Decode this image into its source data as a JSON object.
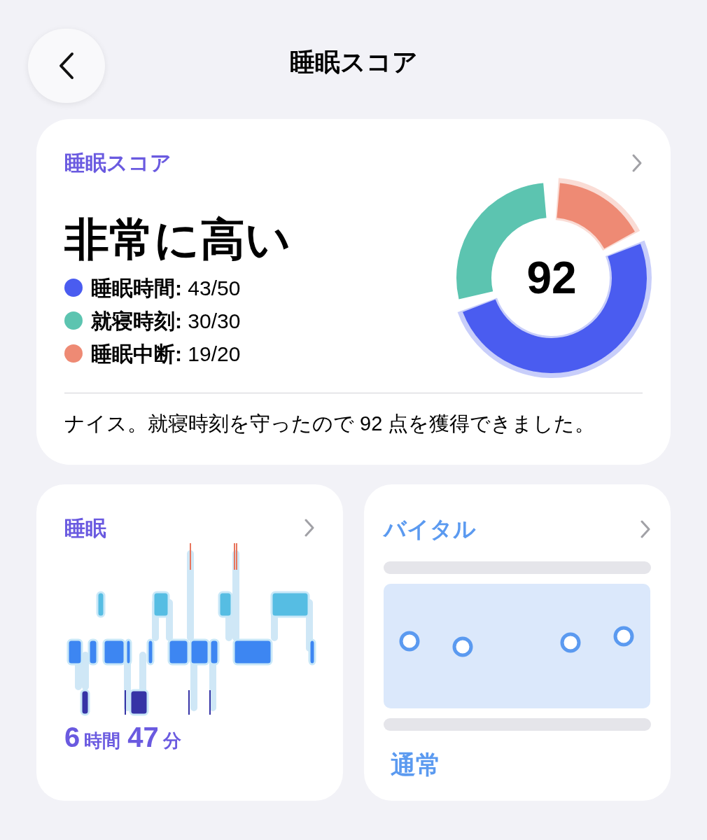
{
  "header": {
    "title": "睡眠スコア"
  },
  "score_card": {
    "title": "睡眠スコア",
    "rating": "非常に高い",
    "score": "92",
    "legend": [
      {
        "text": "**睡眠時間:** 43/50",
        "color": "#4a5cf0"
      },
      {
        "text": "**就寝時刻:** 30/30",
        "color": "#5cc4b0"
      },
      {
        "text": "**睡眠中断:** 19/20",
        "color": "#ee8a74"
      }
    ],
    "message": "ナイス。就寝時刻を守ったので 92 点を獲得できました。"
  },
  "sleep_card": {
    "title": "睡眠",
    "duration": [
      {
        "kind": "value",
        "text": "6"
      },
      {
        "kind": "unit",
        "text": "時間"
      },
      {
        "kind": "value",
        "text": "47"
      },
      {
        "kind": "unit",
        "text": "分"
      }
    ]
  },
  "vitals_card": {
    "title": "バイタル",
    "status": "通常"
  }
}
